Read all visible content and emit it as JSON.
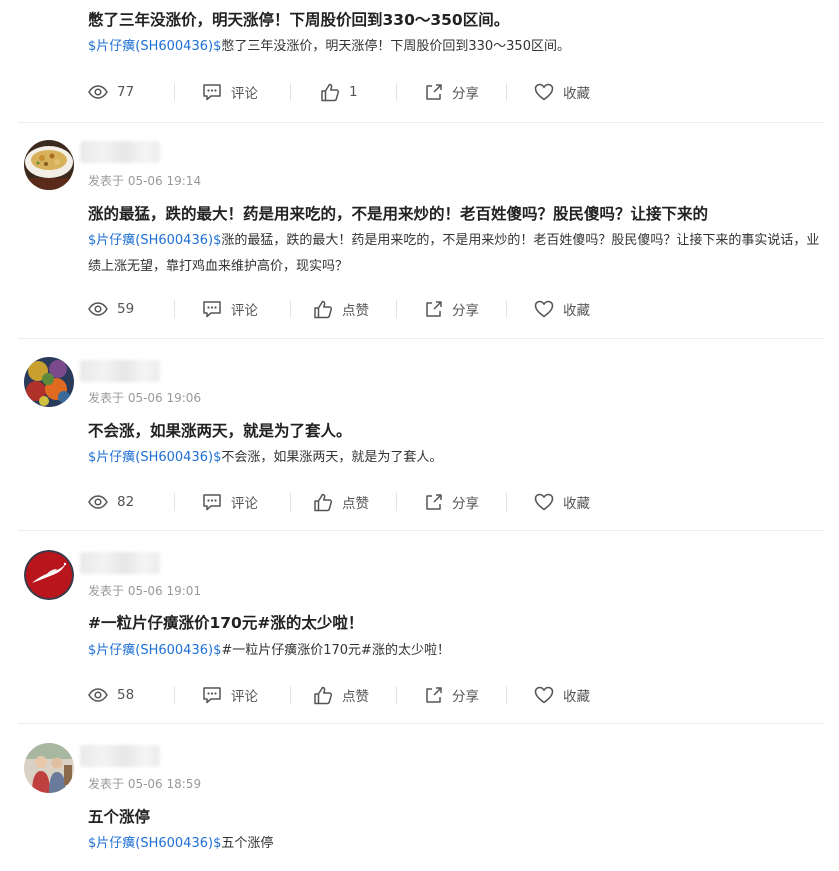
{
  "labels": {
    "comment": "评论",
    "like": "点赞",
    "share": "分享",
    "favorite": "收藏"
  },
  "posts": [
    {
      "title": "憋了三年没涨价，明天涨停！下周股价回到330～350区间。",
      "stock_tag": "$片仔癀(SH600436)$",
      "body": "憋了三年没涨价，明天涨停！下周股价回到330～350区间。",
      "views": "77",
      "likes": "1"
    },
    {
      "posted_at": "发表于 05-06 19:14",
      "title": "涨的最猛，跌的最大！药是用来吃的，不是用来炒的！老百姓傻吗？股民傻吗？让接下来的",
      "stock_tag": "$片仔癀(SH600436)$",
      "body": "涨的最猛，跌的最大！药是用来吃的，不是用来炒的！老百姓傻吗？股民傻吗？让接下来的事实说话，业绩上涨无望，靠打鸡血来维护高价，现实吗？",
      "views": "59",
      "likes": "点赞"
    },
    {
      "posted_at": "发表于 05-06 19:06",
      "title": "不会涨，如果涨两天，就是为了套人。",
      "stock_tag": "$片仔癀(SH600436)$",
      "body": "不会涨，如果涨两天，就是为了套人。",
      "views": "82",
      "likes": "点赞"
    },
    {
      "posted_at": "发表于 05-06 19:01",
      "title": "#一粒片仔癀涨价170元#涨的太少啦！",
      "stock_tag": "$片仔癀(SH600436)$",
      "body": "#一粒片仔癀涨价170元#涨的太少啦！",
      "views": "58",
      "likes": "点赞"
    },
    {
      "posted_at": "发表于 05-06 18:59",
      "title": "五个涨停",
      "stock_tag": "$片仔癀(SH600436)$",
      "body": "五个涨停"
    }
  ],
  "icons": {
    "views": "eye-icon",
    "comment": "comment-icon",
    "like": "thumbs-up-icon",
    "share": "share-icon",
    "favorite": "heart-icon"
  },
  "colors": {
    "stock_tag": "#1e6fd6",
    "title": "#222222",
    "meta": "#999999",
    "action_text": "#555555",
    "divider": "#ececec"
  }
}
